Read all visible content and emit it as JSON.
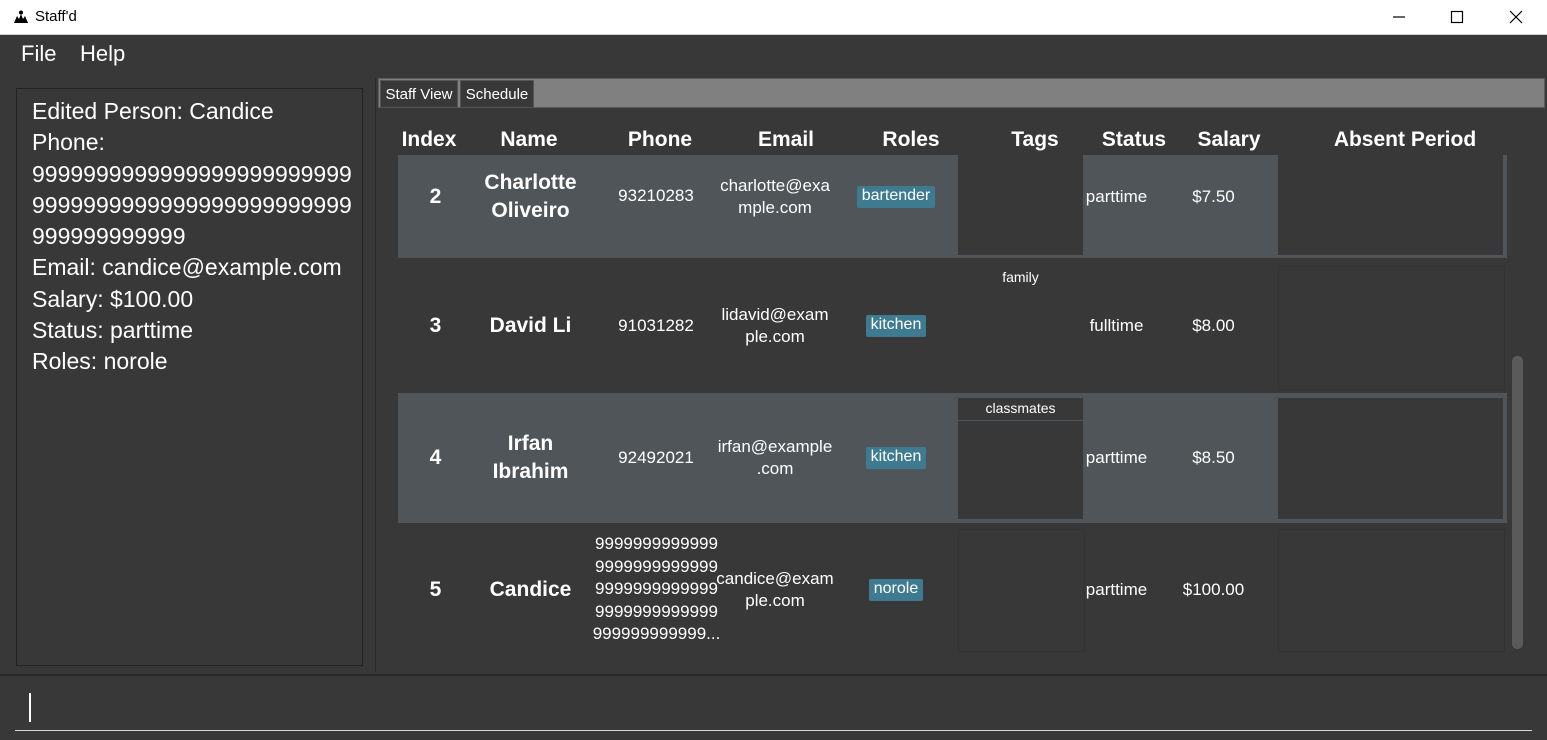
{
  "window": {
    "title": "Staff'd",
    "minimize_icon": "minimize-icon",
    "maximize_icon": "maximize-icon",
    "close_icon": "close-icon"
  },
  "menu": {
    "file": "File",
    "help": "Help"
  },
  "result_display": {
    "lines": [
      "Edited Person: Candice",
      "Phone:",
      "99999999999999999999999999999999999999999999999999999999999999",
      "Email: candice@example.com",
      "Salary: $100.00",
      "Status: parttime",
      "Roles: norole"
    ]
  },
  "tabs": {
    "staff_view": "Staff View",
    "schedule": "Schedule"
  },
  "table": {
    "headers": {
      "index": "Index",
      "name": "Name",
      "phone": "Phone",
      "email": "Email",
      "roles": "Roles",
      "tags": "Tags",
      "status": "Status",
      "salary": "Salary",
      "absent": "Absent Period"
    },
    "rows": [
      {
        "index": "2",
        "name_line1": "Charlotte",
        "name_line2": "Oliveiro",
        "phone": "93210283",
        "email_line1": "charlotte@exa",
        "email_line2": "mple.com",
        "role": "bartender",
        "tag": "",
        "status": "parttime",
        "salary": "$7.50"
      },
      {
        "index": "3",
        "name_line1": "David Li",
        "name_line2": "",
        "phone": "91031282",
        "email_line1": "lidavid@exam",
        "email_line2": "ple.com",
        "role": "kitchen",
        "tag": "family",
        "status": "fulltime",
        "salary": "$8.00"
      },
      {
        "index": "4",
        "name_line1": "Irfan",
        "name_line2": "Ibrahim",
        "phone": "92492021",
        "email_line1": "irfan@example",
        "email_line2": ".com",
        "role": "kitchen",
        "tag": "classmates",
        "status": "parttime",
        "salary": "$8.50"
      },
      {
        "index": "5",
        "name_line1": "Candice",
        "name_line2": "",
        "phone_lines": [
          "9999999999999",
          "9999999999999",
          "9999999999999",
          "9999999999999",
          "999999999999..."
        ],
        "email_line1": "candice@exam",
        "email_line2": "ple.com",
        "role": "norole",
        "tag": "",
        "status": "parttime",
        "salary": "$100.00"
      }
    ]
  },
  "command_box": {
    "value": ""
  }
}
